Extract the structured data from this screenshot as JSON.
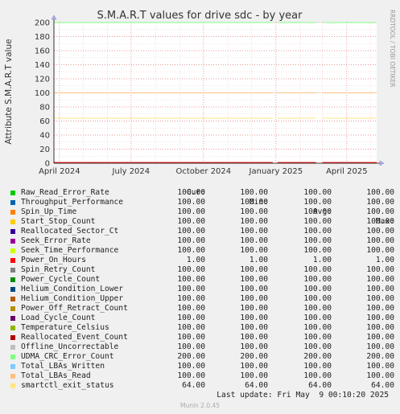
{
  "chart_data": {
    "type": "line",
    "title": "S.M.A.R.T values for drive sdc - by year",
    "ylabel": "Attribute S.M.A.R.T value",
    "side_label": "RRDTOOL / TOBI OETIKER",
    "ylim": [
      0,
      200
    ],
    "y_ticks": [
      0,
      20,
      40,
      60,
      80,
      100,
      120,
      140,
      160,
      180,
      200
    ],
    "x_range": [
      "2024-03-25",
      "2025-05-09"
    ],
    "x_ticks": [
      {
        "date": "2024-04-01",
        "label": "April 2024"
      },
      {
        "date": "2024-07-01",
        "label": "July 2024"
      },
      {
        "date": "2024-10-01",
        "label": "October 2024"
      },
      {
        "date": "2025-01-01",
        "label": "January 2025"
      },
      {
        "date": "2025-04-01",
        "label": "April 2025"
      }
    ],
    "data_gaps": [
      [
        "2024-12-28",
        "2025-01-03"
      ],
      [
        "2025-02-21",
        "2025-03-01"
      ]
    ],
    "grid": true,
    "columns": [
      "Cur:",
      "Min:",
      "Avg:",
      "Max:"
    ],
    "series": [
      {
        "name": "Raw_Read_Error_Rate",
        "color": "#00cc00",
        "cur": "100.00",
        "min": "100.00",
        "avg": "100.00",
        "max": "100.00",
        "value": 100
      },
      {
        "name": "Throughput_Performance",
        "color": "#0066b3",
        "cur": "100.00",
        "min": "100.00",
        "avg": "100.00",
        "max": "100.00",
        "value": 100
      },
      {
        "name": "Spin_Up_Time",
        "color": "#ff8000",
        "cur": "100.00",
        "min": "100.00",
        "avg": "100.00",
        "max": "100.00",
        "value": 100
      },
      {
        "name": "Start_Stop_Count",
        "color": "#ffcc00",
        "cur": "100.00",
        "min": "100.00",
        "avg": "100.00",
        "max": "100.00",
        "value": 100
      },
      {
        "name": "Reallocated_Sector_Ct",
        "color": "#330099",
        "cur": "100.00",
        "min": "100.00",
        "avg": "100.00",
        "max": "100.00",
        "value": 100
      },
      {
        "name": "Seek_Error_Rate",
        "color": "#990099",
        "cur": "100.00",
        "min": "100.00",
        "avg": "100.00",
        "max": "100.00",
        "value": 100
      },
      {
        "name": "Seek_Time_Performance",
        "color": "#ccff00",
        "cur": "100.00",
        "min": "100.00",
        "avg": "100.00",
        "max": "100.00",
        "value": 100
      },
      {
        "name": "Power_On_Hours",
        "color": "#ff0000",
        "cur": "1.00",
        "min": "1.00",
        "avg": "1.00",
        "max": "1.00",
        "value": 1
      },
      {
        "name": "Spin_Retry_Count",
        "color": "#808080",
        "cur": "100.00",
        "min": "100.00",
        "avg": "100.00",
        "max": "100.00",
        "value": 100
      },
      {
        "name": "Power_Cycle_Count",
        "color": "#008f00",
        "cur": "100.00",
        "min": "100.00",
        "avg": "100.00",
        "max": "100.00",
        "value": 100
      },
      {
        "name": "Helium_Condition_Lower",
        "color": "#00487d",
        "cur": "100.00",
        "min": "100.00",
        "avg": "100.00",
        "max": "100.00",
        "value": 100
      },
      {
        "name": "Helium_Condition_Upper",
        "color": "#b35a00",
        "cur": "100.00",
        "min": "100.00",
        "avg": "100.00",
        "max": "100.00",
        "value": 100
      },
      {
        "name": "Power_Off_Retract_Count",
        "color": "#b38f00",
        "cur": "100.00",
        "min": "100.00",
        "avg": "100.00",
        "max": "100.00",
        "value": 100
      },
      {
        "name": "Load_Cycle_Count",
        "color": "#6b006b",
        "cur": "100.00",
        "min": "100.00",
        "avg": "100.00",
        "max": "100.00",
        "value": 100
      },
      {
        "name": "Temperature_Celsius",
        "color": "#8fb300",
        "cur": "100.00",
        "min": "100.00",
        "avg": "100.00",
        "max": "100.00",
        "value": 100
      },
      {
        "name": "Reallocated_Event_Count",
        "color": "#b30000",
        "cur": "100.00",
        "min": "100.00",
        "avg": "100.00",
        "max": "100.00",
        "value": 100
      },
      {
        "name": "Offline_Uncorrectable",
        "color": "#bebebe",
        "cur": "100.00",
        "min": "100.00",
        "avg": "100.00",
        "max": "100.00",
        "value": 100
      },
      {
        "name": "UDMA_CRC_Error_Count",
        "color": "#80ff80",
        "cur": "200.00",
        "min": "200.00",
        "avg": "200.00",
        "max": "200.00",
        "value": 200
      },
      {
        "name": "Total_LBAs_Written",
        "color": "#80c9ff",
        "cur": "100.00",
        "min": "100.00",
        "avg": "100.00",
        "max": "100.00",
        "value": 100
      },
      {
        "name": "Total_LBAs_Read",
        "color": "#ffc080",
        "cur": "100.00",
        "min": "100.00",
        "avg": "100.00",
        "max": "100.00",
        "value": 100
      },
      {
        "name": "smartctl_exit_status",
        "color": "#ffe680",
        "cur": "64.00",
        "min": "64.00",
        "avg": "64.00",
        "max": "64.00",
        "value": 64
      }
    ]
  },
  "last_update": "Last update: Fri May  9 00:10:20 2025",
  "footer": "Munin 2.0.45"
}
